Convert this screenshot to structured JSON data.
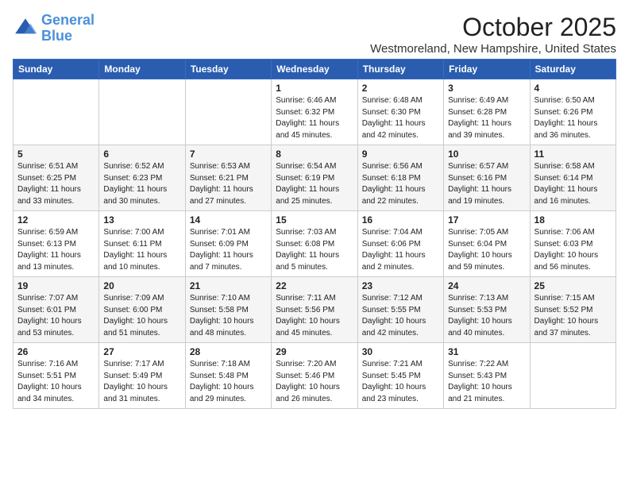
{
  "logo": {
    "line1": "General",
    "line2": "Blue"
  },
  "title": "October 2025",
  "subtitle": "Westmoreland, New Hampshire, United States",
  "days_of_week": [
    "Sunday",
    "Monday",
    "Tuesday",
    "Wednesday",
    "Thursday",
    "Friday",
    "Saturday"
  ],
  "weeks": [
    [
      {
        "day": "",
        "info": ""
      },
      {
        "day": "",
        "info": ""
      },
      {
        "day": "",
        "info": ""
      },
      {
        "day": "1",
        "info": "Sunrise: 6:46 AM\nSunset: 6:32 PM\nDaylight: 11 hours and 45 minutes."
      },
      {
        "day": "2",
        "info": "Sunrise: 6:48 AM\nSunset: 6:30 PM\nDaylight: 11 hours and 42 minutes."
      },
      {
        "day": "3",
        "info": "Sunrise: 6:49 AM\nSunset: 6:28 PM\nDaylight: 11 hours and 39 minutes."
      },
      {
        "day": "4",
        "info": "Sunrise: 6:50 AM\nSunset: 6:26 PM\nDaylight: 11 hours and 36 minutes."
      }
    ],
    [
      {
        "day": "5",
        "info": "Sunrise: 6:51 AM\nSunset: 6:25 PM\nDaylight: 11 hours and 33 minutes."
      },
      {
        "day": "6",
        "info": "Sunrise: 6:52 AM\nSunset: 6:23 PM\nDaylight: 11 hours and 30 minutes."
      },
      {
        "day": "7",
        "info": "Sunrise: 6:53 AM\nSunset: 6:21 PM\nDaylight: 11 hours and 27 minutes."
      },
      {
        "day": "8",
        "info": "Sunrise: 6:54 AM\nSunset: 6:19 PM\nDaylight: 11 hours and 25 minutes."
      },
      {
        "day": "9",
        "info": "Sunrise: 6:56 AM\nSunset: 6:18 PM\nDaylight: 11 hours and 22 minutes."
      },
      {
        "day": "10",
        "info": "Sunrise: 6:57 AM\nSunset: 6:16 PM\nDaylight: 11 hours and 19 minutes."
      },
      {
        "day": "11",
        "info": "Sunrise: 6:58 AM\nSunset: 6:14 PM\nDaylight: 11 hours and 16 minutes."
      }
    ],
    [
      {
        "day": "12",
        "info": "Sunrise: 6:59 AM\nSunset: 6:13 PM\nDaylight: 11 hours and 13 minutes."
      },
      {
        "day": "13",
        "info": "Sunrise: 7:00 AM\nSunset: 6:11 PM\nDaylight: 11 hours and 10 minutes."
      },
      {
        "day": "14",
        "info": "Sunrise: 7:01 AM\nSunset: 6:09 PM\nDaylight: 11 hours and 7 minutes."
      },
      {
        "day": "15",
        "info": "Sunrise: 7:03 AM\nSunset: 6:08 PM\nDaylight: 11 hours and 5 minutes."
      },
      {
        "day": "16",
        "info": "Sunrise: 7:04 AM\nSunset: 6:06 PM\nDaylight: 11 hours and 2 minutes."
      },
      {
        "day": "17",
        "info": "Sunrise: 7:05 AM\nSunset: 6:04 PM\nDaylight: 10 hours and 59 minutes."
      },
      {
        "day": "18",
        "info": "Sunrise: 7:06 AM\nSunset: 6:03 PM\nDaylight: 10 hours and 56 minutes."
      }
    ],
    [
      {
        "day": "19",
        "info": "Sunrise: 7:07 AM\nSunset: 6:01 PM\nDaylight: 10 hours and 53 minutes."
      },
      {
        "day": "20",
        "info": "Sunrise: 7:09 AM\nSunset: 6:00 PM\nDaylight: 10 hours and 51 minutes."
      },
      {
        "day": "21",
        "info": "Sunrise: 7:10 AM\nSunset: 5:58 PM\nDaylight: 10 hours and 48 minutes."
      },
      {
        "day": "22",
        "info": "Sunrise: 7:11 AM\nSunset: 5:56 PM\nDaylight: 10 hours and 45 minutes."
      },
      {
        "day": "23",
        "info": "Sunrise: 7:12 AM\nSunset: 5:55 PM\nDaylight: 10 hours and 42 minutes."
      },
      {
        "day": "24",
        "info": "Sunrise: 7:13 AM\nSunset: 5:53 PM\nDaylight: 10 hours and 40 minutes."
      },
      {
        "day": "25",
        "info": "Sunrise: 7:15 AM\nSunset: 5:52 PM\nDaylight: 10 hours and 37 minutes."
      }
    ],
    [
      {
        "day": "26",
        "info": "Sunrise: 7:16 AM\nSunset: 5:51 PM\nDaylight: 10 hours and 34 minutes."
      },
      {
        "day": "27",
        "info": "Sunrise: 7:17 AM\nSunset: 5:49 PM\nDaylight: 10 hours and 31 minutes."
      },
      {
        "day": "28",
        "info": "Sunrise: 7:18 AM\nSunset: 5:48 PM\nDaylight: 10 hours and 29 minutes."
      },
      {
        "day": "29",
        "info": "Sunrise: 7:20 AM\nSunset: 5:46 PM\nDaylight: 10 hours and 26 minutes."
      },
      {
        "day": "30",
        "info": "Sunrise: 7:21 AM\nSunset: 5:45 PM\nDaylight: 10 hours and 23 minutes."
      },
      {
        "day": "31",
        "info": "Sunrise: 7:22 AM\nSunset: 5:43 PM\nDaylight: 10 hours and 21 minutes."
      },
      {
        "day": "",
        "info": ""
      }
    ]
  ]
}
